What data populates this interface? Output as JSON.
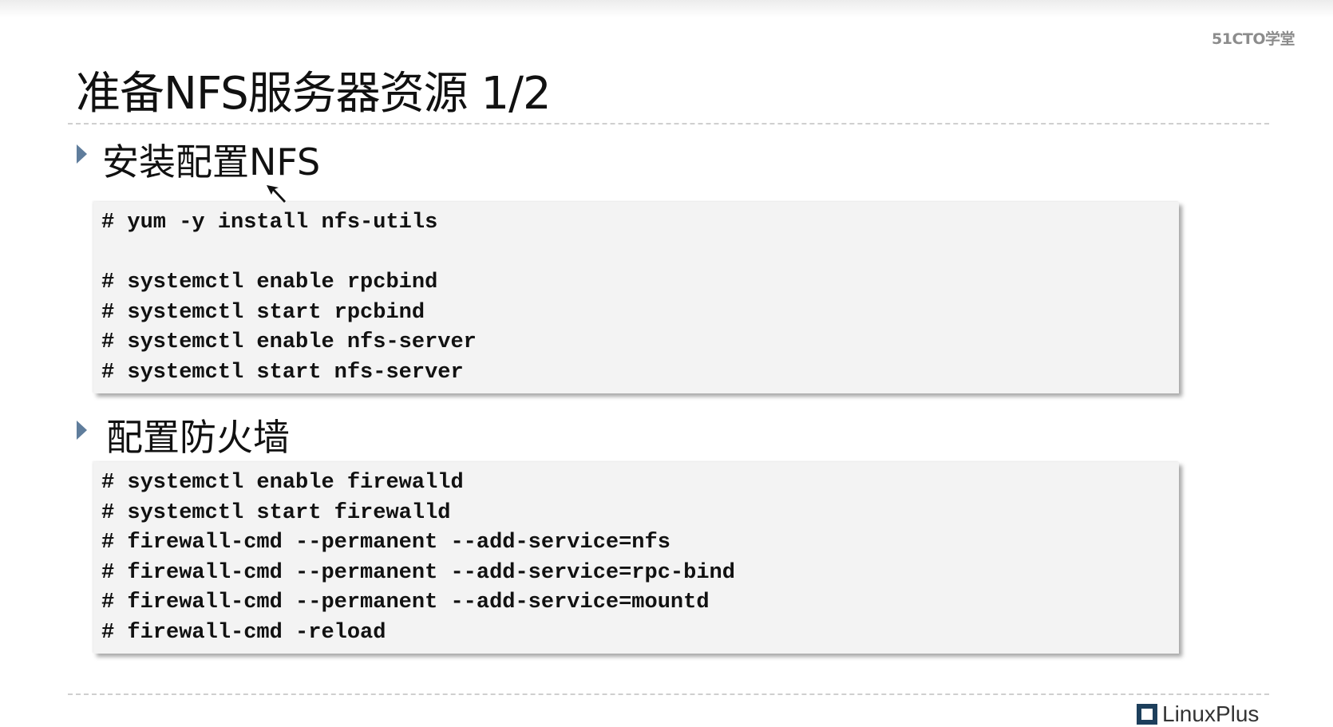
{
  "watermark": "51CTO学堂",
  "slide": {
    "title": "准备NFS服务器资源 1/2"
  },
  "sections": [
    {
      "heading": "安装配置NFS",
      "code": [
        "# yum -y install nfs-utils",
        "",
        "# systemctl enable rpcbind",
        "# systemctl start rpcbind",
        "# systemctl enable nfs-server",
        "# systemctl start nfs-server"
      ]
    },
    {
      "heading": "配置防火墙",
      "code": [
        "# systemctl enable firewalld",
        "# systemctl start firewalld",
        "# firewall-cmd --permanent --add-service=nfs",
        "# firewall-cmd --permanent --add-service=rpc-bind",
        "# firewall-cmd --permanent --add-service=mountd",
        "# firewall-cmd -reload"
      ]
    }
  ],
  "footer": {
    "logo_text": "LinuxPlus"
  },
  "colors": {
    "bullet": "#5f7d9c",
    "code_background": "#f3f3f3",
    "logo_mark": "#1d3f5c"
  },
  "icons": {
    "bullet": "triangle-right-icon",
    "cursor": "mouse-pointer-icon",
    "logo": "linuxplus-logo-icon"
  }
}
